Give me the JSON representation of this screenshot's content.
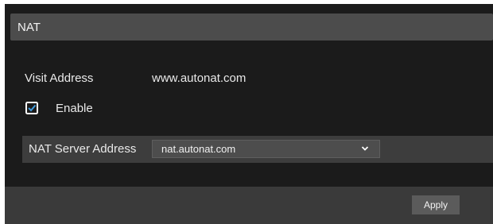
{
  "header": {
    "title": "NAT"
  },
  "visit": {
    "label": "Visit Address",
    "value": "www.autonat.com"
  },
  "enable": {
    "label": "Enable",
    "checked": true,
    "icon": "checkbox-checked-icon"
  },
  "nat_server": {
    "label": "NAT Server Address",
    "selected": "nat.autonat.com",
    "icon": "chevron-down-icon"
  },
  "footer": {
    "apply_label": "Apply"
  },
  "colors": {
    "background": "#1b1b1b",
    "header": "#4c4c4c",
    "row": "#3d3d3d",
    "footer": "#3a3a3a",
    "button": "#5b5b5b",
    "checkbox_accent": "#3f9bdc"
  }
}
